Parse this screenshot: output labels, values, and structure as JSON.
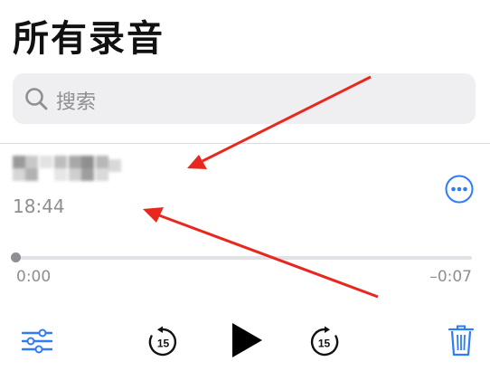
{
  "header": {
    "title": "所有录音"
  },
  "search": {
    "placeholder": "搜索"
  },
  "recording": {
    "time": "18:44",
    "position": "0:00",
    "remaining": "–0:07",
    "progress": 0
  },
  "icons": {
    "search": "search-icon",
    "more": "more-options-icon",
    "settings": "sliders-icon",
    "skip_back": "skip-back-15-icon",
    "play": "play-icon",
    "skip_forward": "skip-forward-15-icon",
    "delete": "trash-icon"
  },
  "controls": {
    "skip_seconds": "15"
  },
  "colors": {
    "accent": "#2f7cf6",
    "annotation": "#e8281e",
    "secondary_text": "#8e8e93",
    "search_bg": "#efeff2"
  }
}
